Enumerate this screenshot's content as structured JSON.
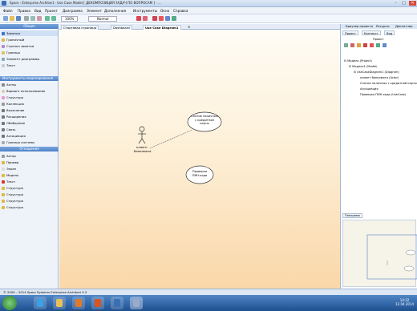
{
  "window": {
    "title": "Sparx - Enterprise Architect - Use Case Model [ ДЕКОМПОЗИЦИЯ ЗАДАЧ ПО ВОПРОСАМ ] - ...",
    "min": "–",
    "max": "□",
    "close": "✕"
  },
  "menu": [
    "Файл",
    "Правка",
    "Вид",
    "Проект",
    "Диаграмма",
    "Элемент",
    "Дополнения",
    "Инструменты",
    "Окно",
    "Справка"
  ],
  "toolbar": {
    "zoom": "100%",
    "mode": "Normal"
  },
  "left_panel": {
    "header": "Общие",
    "items": [
      "Заметки",
      "Граничный",
      "Стрелка заметки",
      "Граница",
      "Элемент диаграммы",
      "Текст"
    ],
    "section2": "Инструменты моделирования",
    "items2": [
      "Актер",
      "Вариант использования",
      "Структура",
      "Коллекция",
      "Включение",
      "Расширение",
      "Обобщение",
      "Связь",
      "Ассоциация",
      "Граница системы"
    ],
    "section3": "Отношения",
    "items3": [
      "Актор",
      "Пример",
      "Экран",
      "Модель",
      "Текст",
      "Структура",
      "Структура",
      "Структура",
      "Структура"
    ]
  },
  "tabs": [
    "Стартовая страница",
    "Dashboard",
    "Use Case Diagram1"
  ],
  "diagram": {
    "actor_label": "клиент банкомата",
    "usecase1": "Снятие наличных с кредитной карты",
    "usecase2": "Проверка ПИН-кода"
  },
  "right_panel": {
    "header": "Браузер проекта",
    "header2": "Ресурсы",
    "header3": "Диспетчер",
    "tabs": [
      "Проект",
      "Контекст",
      "Вид"
    ],
    "root_label": "Проект",
    "tree": [
      "Модель (Project)",
      "Модель1 (Model)",
      "UseCaseDiagram1 (Diagram)",
      "клиент банкомата (Actor)",
      "Снятие наличных с кредитной карты",
      "Ассоциация",
      "Проверка ПИН-кода (UseCase)"
    ],
    "mini_tab": "Панорама"
  },
  "status": "© 2009 – 2014 Sparx Systems Enterprise Architect 9.3",
  "clock": {
    "time": "14:32",
    "date": "12.04.2014"
  }
}
